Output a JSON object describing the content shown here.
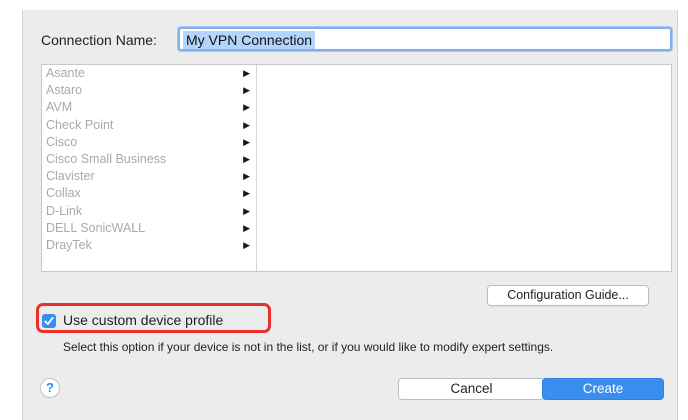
{
  "connection": {
    "label": "Connection Name:",
    "value": "My VPN Connection"
  },
  "vendors": [
    "Asante",
    "Astaro",
    "AVM",
    "Check Point",
    "Cisco",
    "Cisco Small Business",
    "Clavister",
    "Collax",
    "D-Link",
    "DELL SonicWALL",
    "DrayTek"
  ],
  "vendor_arrow_icon": "disclosure-triangle-icon",
  "buttons": {
    "config_guide": "Configuration Guide...",
    "cancel": "Cancel",
    "create": "Create",
    "help": "?"
  },
  "custom_profile": {
    "checked": true,
    "label": "Use custom device profile",
    "hint": "Select this option if your device is not in the list, or if you would like to modify expert settings."
  },
  "colors": {
    "accent": "#3a8fee",
    "highlight_annotation": "#e8312a"
  }
}
